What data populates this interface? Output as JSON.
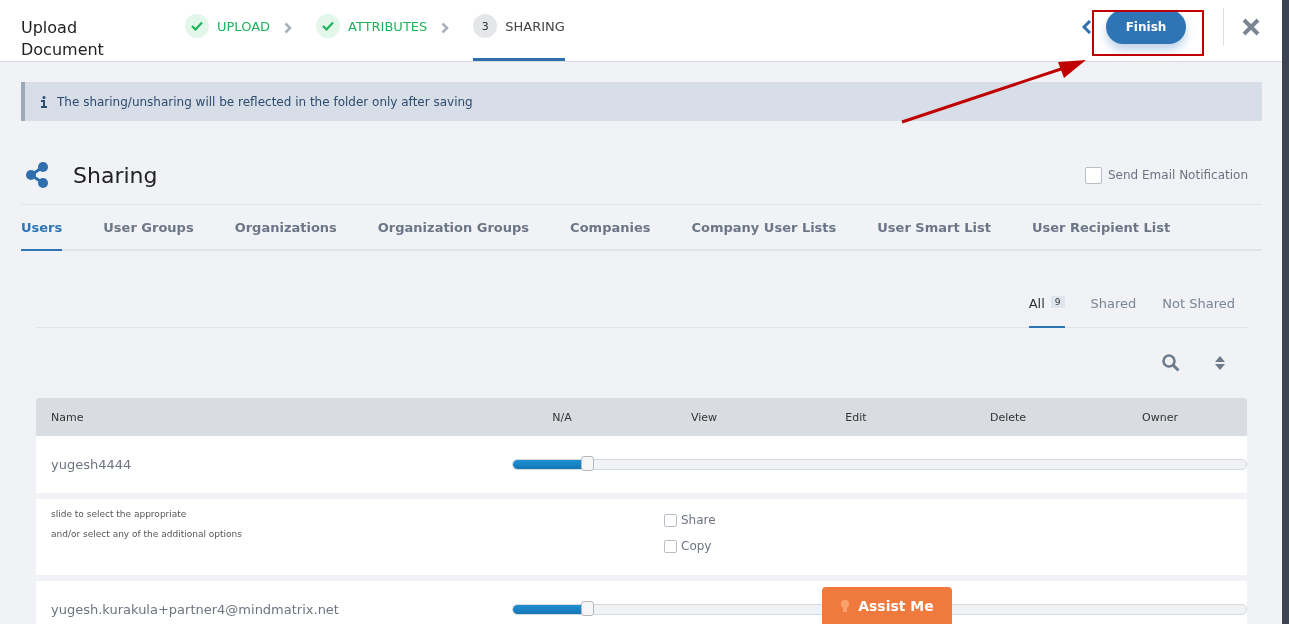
{
  "window": {
    "title": "Upload Document"
  },
  "steps": [
    {
      "label": "UPLOAD",
      "done": true,
      "selected": false
    },
    {
      "label": "ATTRIBUTES",
      "done": true,
      "selected": false
    },
    {
      "label": "SHARING",
      "number": "3",
      "done": false,
      "selected": true
    }
  ],
  "finish_button": "Finish",
  "info_banner": "The sharing/unsharing will be reflected in the folder only after saving",
  "section": {
    "title": "Sharing",
    "notify": {
      "label": "Send Email Notification",
      "checked": false
    }
  },
  "tabs": [
    {
      "label": "Users",
      "selected": true
    },
    {
      "label": "User Groups",
      "selected": false
    },
    {
      "label": "Organizations",
      "selected": false
    },
    {
      "label": "Organization Groups",
      "selected": false
    },
    {
      "label": "Companies",
      "selected": false
    },
    {
      "label": "Company User Lists",
      "selected": false
    },
    {
      "label": "User Smart List",
      "selected": false
    },
    {
      "label": "User Recipient List",
      "selected": false
    }
  ],
  "filters": [
    {
      "label": "All",
      "count": "9",
      "selected": true
    },
    {
      "label": "Shared",
      "selected": false
    },
    {
      "label": "Not Shared",
      "selected": false
    }
  ],
  "table": {
    "columns": [
      "Name",
      "N/A",
      "View",
      "Edit",
      "Delete",
      "Owner"
    ],
    "rows": [
      {
        "kind": "user",
        "name": "yugesh4444",
        "level": 0.1
      },
      {
        "kind": "options",
        "hint": [
          "slide to select the appropriate",
          "and/or select any of the additional options"
        ],
        "options": [
          {
            "label": "Share",
            "checked": false
          },
          {
            "label": "Copy",
            "checked": false
          }
        ]
      },
      {
        "kind": "user",
        "name": "yugesh.kurakula+partner4@mindmatrix.net",
        "level": 0.1
      }
    ]
  },
  "assist_button": "Assist Me"
}
